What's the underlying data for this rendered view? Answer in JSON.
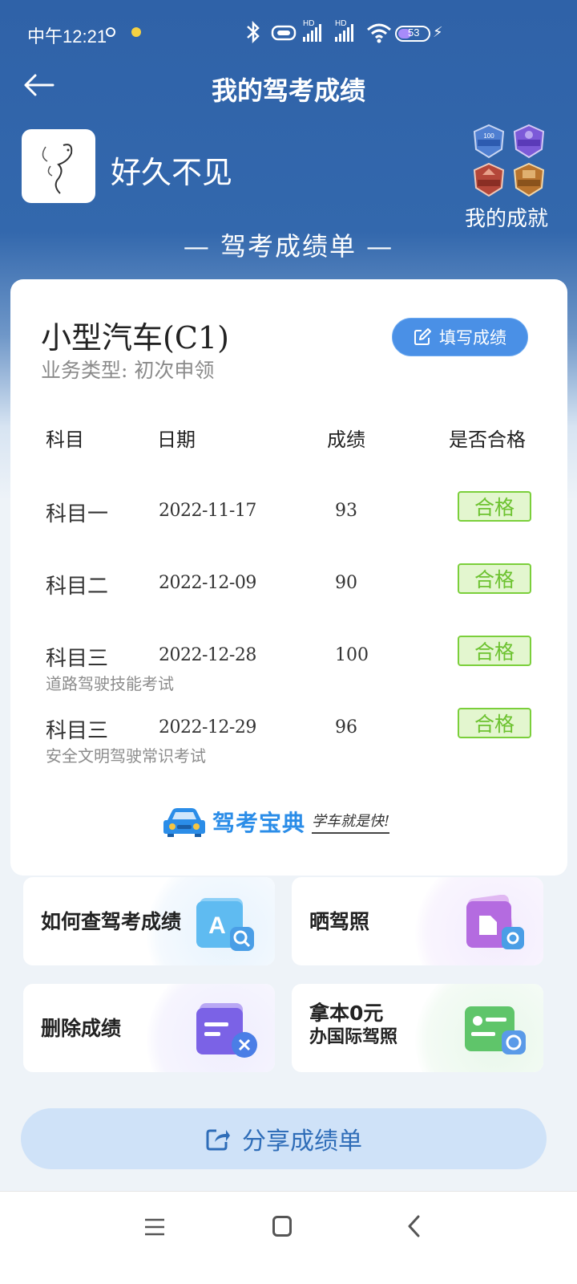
{
  "status_bar": {
    "time": "中午12:21",
    "battery": "53",
    "hd1": "HD",
    "hd2": "HD"
  },
  "header": {
    "title": "我的驾考成绩",
    "back_icon": "arrow-left-icon"
  },
  "profile": {
    "username": "好久不见",
    "achievements_label": "我的成就"
  },
  "sheet_heading": "— 驾考成绩单 —",
  "card": {
    "license_type": "小型汽车(C1)",
    "business_type": "业务类型: 初次申领",
    "fill_button": "填写成绩",
    "columns": [
      "科目",
      "日期",
      "成绩",
      "是否合格"
    ],
    "rows": [
      {
        "subject": "科目一",
        "sub": "",
        "date": "2022-11-17",
        "score": "93",
        "status": "合格"
      },
      {
        "subject": "科目二",
        "sub": "",
        "date": "2022-12-09",
        "score": "90",
        "status": "合格"
      },
      {
        "subject": "科目三",
        "sub": "道路驾驶技能考试",
        "date": "2022-12-28",
        "score": "100",
        "status": "合格"
      },
      {
        "subject": "科目三",
        "sub": "安全文明驾驶常识考试",
        "date": "2022-12-29",
        "score": "96",
        "status": "合格"
      }
    ],
    "brand_name": "驾考宝典",
    "brand_slogan": "学车就是快!"
  },
  "tiles": [
    {
      "label": "如何查驾考成绩",
      "icon": "search-document-icon"
    },
    {
      "label": "晒驾照",
      "icon": "photo-share-icon"
    },
    {
      "label": "删除成绩",
      "icon": "delete-document-icon"
    },
    {
      "label_line1": "拿本0元",
      "label_line2": "办国际驾照",
      "icon": "international-license-icon"
    }
  ],
  "share_button": "分享成绩单",
  "colors": {
    "header_blue": "#3368ad",
    "pass_green": "#6cc22f",
    "button_blue": "#4a90e6"
  }
}
